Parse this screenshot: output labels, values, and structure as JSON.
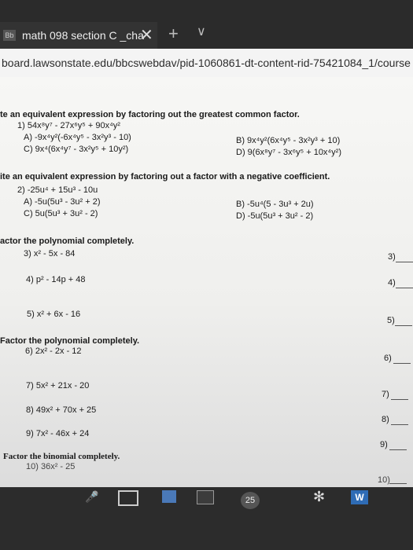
{
  "browser": {
    "tab_favicon": "Bb",
    "tab_title": "math 098 section C _cha",
    "tab_close": "✕",
    "new_tab": "+",
    "tab_menu": "∨",
    "url": "board.lawsonstate.edu/bbcswebdav/pid-1060861-dt-content-rid-75421084_1/course"
  },
  "worksheet": {
    "section1_heading": "te an equivalent expression by factoring out the greatest common factor.",
    "q1": {
      "prompt": "1) 54x⁸y⁷ - 27x⁶y⁵ + 90x⁴y²",
      "A": "A) -9x⁴y²(-6x⁴y⁵ - 3x²y³ - 10)",
      "B": "B) 9x⁴y²(6x⁴y⁵ - 3x²y³ + 10)",
      "C": "C) 9x⁴(6x⁴y⁷ - 3x²y⁵ + 10y²)",
      "D": "D) 9(6x⁸y⁷ - 3x⁶y⁵ + 10x⁴y²)"
    },
    "section2_heading": "ite an equivalent expression by factoring out a factor with a negative coefficient.",
    "q2": {
      "prompt": "2) -25u⁴ + 15u³ - 10u",
      "A": "A) -5u(5u³ - 3u² + 2)",
      "B": "B) -5u⁴(5 - 3u³ + 2u)",
      "C": "C) 5u(5u³ + 3u² - 2)",
      "D": "D) -5u(5u³ + 3u² - 2)"
    },
    "section3_heading": "actor the polynomial completely.",
    "q3": "3) x² - 5x - 84",
    "q3_label": "3)",
    "q4": "4) p² - 14p + 48",
    "q4_label": "4)",
    "q5": "5) x² + 6x - 16",
    "q5_label": "5)",
    "section4_heading": "Factor the polynomial completely.",
    "q6": "6) 2x² - 2x - 12",
    "q6_label": "6)",
    "q7": "7) 5x² + 21x - 20",
    "q7_label": "7)",
    "q8": "8) 49x² + 70x + 25",
    "q8_label": "8)",
    "q9": "9) 7x² - 46x + 24",
    "q9_label": "9)",
    "section5_heading": "Factor the binomial completely.",
    "q10": "10) 36x² - 25",
    "q10_label": "10)"
  },
  "taskbar": {
    "badge": "25"
  }
}
